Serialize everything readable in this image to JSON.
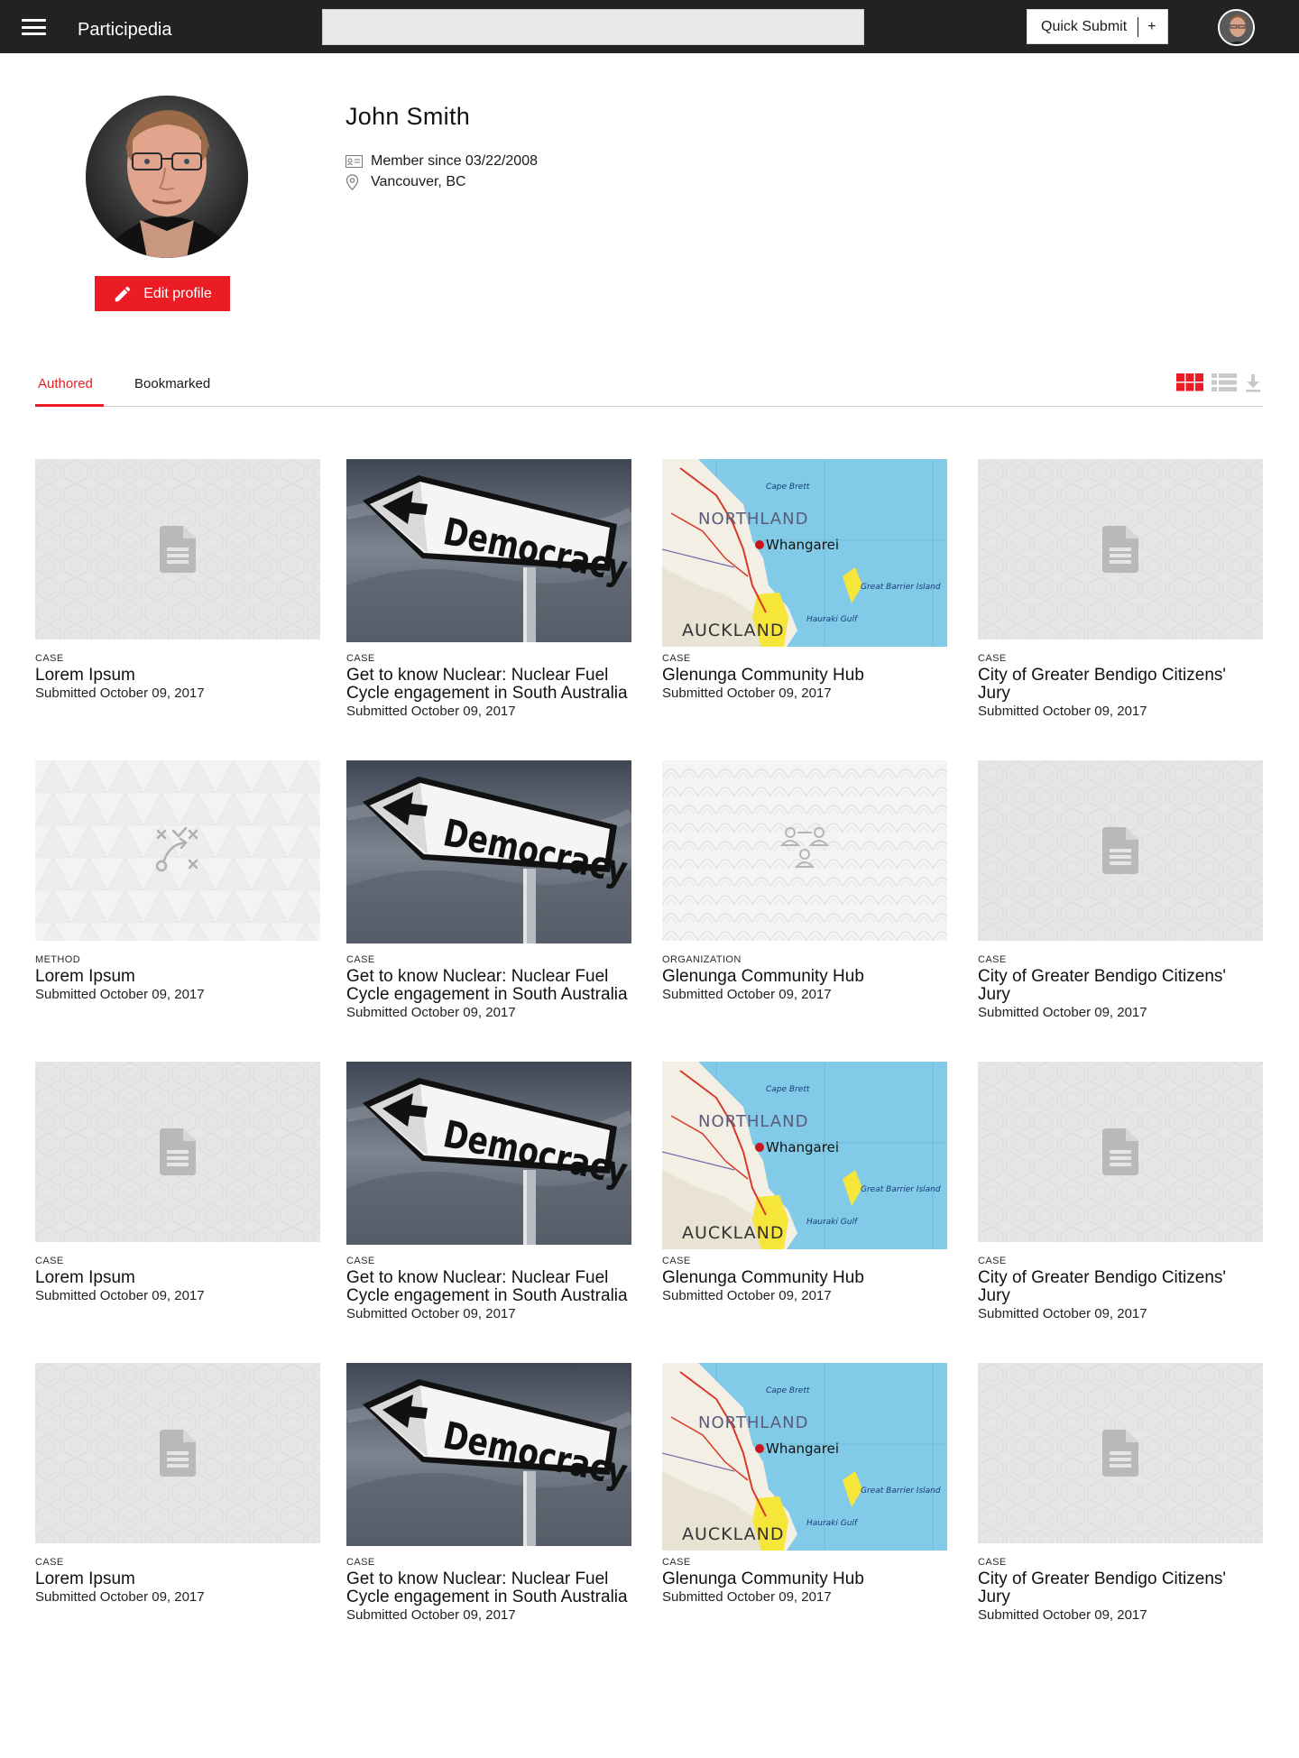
{
  "app": {
    "name": "Participedia"
  },
  "header": {
    "search_placeholder": "",
    "quick_submit_label": "Quick Submit",
    "quick_submit_plus": "+"
  },
  "profile": {
    "name": "John Smith",
    "member_since": "Member since 03/22/2008",
    "location": "Vancouver, BC",
    "edit_label": "Edit profile"
  },
  "tabs": [
    {
      "label": "Authored",
      "active": true
    },
    {
      "label": "Bookmarked",
      "active": false
    }
  ],
  "view_toggles": [
    "grid-view-icon",
    "list-view-icon",
    "download-icon"
  ],
  "colors": {
    "accent": "#ec1c24",
    "topbar": "#222222"
  },
  "cards": [
    {
      "type": "CASE",
      "title": "Lorem Ipsum",
      "date": "Submitted October 09, 2017",
      "thumb": "doc"
    },
    {
      "type": "CASE",
      "title": "Get to know Nuclear: Nuclear Fuel Cycle engagement in South Australia",
      "date": "Submitted October 09, 2017",
      "thumb": "democracy"
    },
    {
      "type": "CASE",
      "title": "Glenunga Community Hub",
      "date": "Submitted October 09, 2017",
      "thumb": "map"
    },
    {
      "type": "CASE",
      "title": "City of Greater Bendigo Citizens' Jury",
      "date": "Submitted October 09, 2017",
      "thumb": "doc"
    },
    {
      "type": "METHOD",
      "title": "Lorem Ipsum",
      "date": "Submitted October 09, 2017",
      "thumb": "method"
    },
    {
      "type": "CASE",
      "title": "Get to know Nuclear: Nuclear Fuel Cycle engagement in South Australia",
      "date": "Submitted October 09, 2017",
      "thumb": "democracy"
    },
    {
      "type": "ORGANIZATION",
      "title": "Glenunga Community Hub",
      "date": "Submitted October 09, 2017",
      "thumb": "org"
    },
    {
      "type": "CASE",
      "title": "City of Greater Bendigo Citizens' Jury",
      "date": "Submitted October 09, 2017",
      "thumb": "doc"
    },
    {
      "type": "CASE",
      "title": "Lorem Ipsum",
      "date": "Submitted October 09, 2017",
      "thumb": "doc"
    },
    {
      "type": "CASE",
      "title": "Get to know Nuclear: Nuclear Fuel Cycle engagement in South Australia",
      "date": "Submitted October 09, 2017",
      "thumb": "democracy"
    },
    {
      "type": "CASE",
      "title": "Glenunga Community Hub",
      "date": "Submitted October 09, 2017",
      "thumb": "map"
    },
    {
      "type": "CASE",
      "title": "City of Greater Bendigo Citizens' Jury",
      "date": "Submitted October 09, 2017",
      "thumb": "doc"
    },
    {
      "type": "CASE",
      "title": "Lorem Ipsum",
      "date": "Submitted October 09, 2017",
      "thumb": "doc"
    },
    {
      "type": "CASE",
      "title": "Get to know Nuclear: Nuclear Fuel Cycle engagement in South Australia",
      "date": "Submitted October 09, 2017",
      "thumb": "democracy"
    },
    {
      "type": "CASE",
      "title": "Glenunga Community Hub",
      "date": "Submitted October 09, 2017",
      "thumb": "map"
    },
    {
      "type": "CASE",
      "title": "City of Greater Bendigo Citizens' Jury",
      "date": "Submitted October 09, 2017",
      "thumb": "doc"
    }
  ],
  "map_labels": {
    "cape": "Cape Brett",
    "region": "NORTHLAND",
    "city": "Whangarei",
    "island": "Great Barrier Island",
    "gulf": "Hauraki Gulf",
    "metro": "AUCKLAND"
  },
  "sign_text": "Democracy"
}
